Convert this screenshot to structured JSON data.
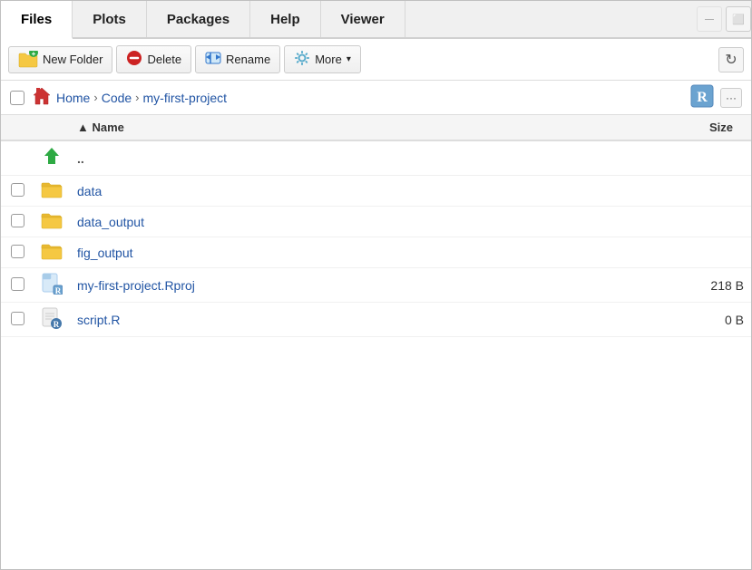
{
  "tabs": [
    {
      "label": "Files",
      "active": true
    },
    {
      "label": "Plots",
      "active": false
    },
    {
      "label": "Packages",
      "active": false
    },
    {
      "label": "Help",
      "active": false
    },
    {
      "label": "Viewer",
      "active": false
    }
  ],
  "toolbar": {
    "new_folder_label": "New Folder",
    "delete_label": "Delete",
    "rename_label": "Rename",
    "more_label": "More",
    "more_dropdown_icon": "▾"
  },
  "breadcrumb": {
    "home_label": "Home",
    "sep1": "›",
    "code_label": "Code",
    "sep2": "›",
    "current": "my-first-project"
  },
  "table": {
    "col_name": "Name",
    "col_sort": "▲",
    "col_size": "Size",
    "rows": [
      {
        "name": "..",
        "type": "up",
        "size": ""
      },
      {
        "name": "data",
        "type": "folder",
        "size": ""
      },
      {
        "name": "data_output",
        "type": "folder",
        "size": ""
      },
      {
        "name": "fig_output",
        "type": "folder",
        "size": ""
      },
      {
        "name": "my-first-project.Rproj",
        "type": "rproj",
        "size": "218 B"
      },
      {
        "name": "script.R",
        "type": "r",
        "size": "0 B"
      }
    ]
  },
  "colors": {
    "link": "#2255a4",
    "folder_yellow": "#f5c842",
    "up_green": "#2eaa44",
    "gear_blue": "#5aaccc"
  }
}
